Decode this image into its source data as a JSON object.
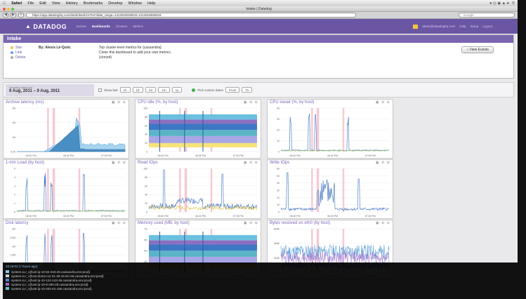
{
  "menubar": {
    "app": "Safari",
    "items": [
      "File",
      "Edit",
      "View",
      "History",
      "Bookmarks",
      "Develop",
      "Window",
      "Help"
    ]
  },
  "window": {
    "title": "Intake | Datadog"
  },
  "browser": {
    "url": "https://app.datadoghq.com/dash/dash/10754?date_range=1312919039043-1312919839043",
    "search_placeholder": "Google"
  },
  "datadog_nav": {
    "logo": "DATADOG",
    "links": [
      "Events",
      "Dashboards",
      "Clusters",
      "Metrics"
    ],
    "active": "Dashboards",
    "right": [
      "alexis@datadoghq.com",
      "Help",
      "Setup",
      "Logout"
    ]
  },
  "dashboard": {
    "title": "Intake",
    "actions": [
      {
        "label": "Star",
        "color": "#f6c443"
      },
      {
        "label": "Link",
        "color": "#6a9de0"
      },
      {
        "label": "Delete",
        "color": "#aaaaaa"
      }
    ],
    "author": "By: Alexis Lê-Quôc",
    "description_lines": [
      "Top cluster-level metrics for {cassandra}.",
      "Clone this dashboard to add your own metrics.",
      "(cloned)"
    ],
    "events_button": "View Events"
  },
  "timebar": {
    "label": "Showing data from",
    "range": "9 Aug, 2011 – 9 Aug, 2011",
    "show_last": "Show last",
    "ranges": [
      "1h",
      "1d",
      "1w",
      "1m",
      "1y"
    ],
    "pick": "Pick custom dates",
    "from": "From",
    "to": "To"
  },
  "panels": [
    {
      "title": "Archive latency (ms)",
      "yticks": [
        "2M",
        "1M",
        "1M",
        "0.00"
      ],
      "style": "area-blue"
    },
    {
      "title": "CPU idle (%, by host)",
      "yticks": [
        "100",
        "80",
        "60",
        "40",
        "20",
        "0"
      ],
      "style": "stack-band"
    },
    {
      "title": "CPU iowait (%, by host)",
      "yticks": [
        "40",
        "30",
        "20",
        "10",
        "0"
      ],
      "style": "spikes-low"
    },
    {
      "title": "1-min Load (by host)",
      "yticks": [
        "5",
        "4",
        "3",
        "2",
        "1",
        "0"
      ],
      "style": "spikes-low"
    },
    {
      "title": "Read IOps",
      "yticks": [
        "100",
        "80",
        "60",
        "40",
        "20",
        "0"
      ],
      "style": "read-iops"
    },
    {
      "title": "Write IOps",
      "yticks": [
        "60",
        "50",
        "40",
        "30",
        "20",
        "10",
        "0"
      ],
      "style": "write-iops"
    },
    {
      "title": "Disk latency",
      "yticks": [
        "3M",
        "2.5M",
        "2M",
        "1.5M",
        "1M",
        "0.5M"
      ],
      "style": "spikes-low"
    },
    {
      "title": "Memory used (MB, by host)",
      "yticks": [
        "7G",
        "6G",
        "5G",
        "4G",
        "3G"
      ],
      "style": "stack-band"
    },
    {
      "title": "Bytes received on eth0 (by host)",
      "yticks": [
        "800K",
        "600K",
        "400K",
        "200K"
      ],
      "style": "noisy"
    }
  ],
  "x_ticks": [
    "06:00 PM",
    "06:30 PM",
    "07:00 PM"
  ],
  "tooltip": {
    "header": "16:19:03 (7 hours ago)",
    "series": [
      {
        "color": "#8ec6f0",
        "label": "system.io.r_s{host:ip-10-82-234-28.cassandra,env:prod}"
      },
      {
        "color": "#cfcfcf",
        "label": "system.io.r_s{host:domU-12-31-39-16-8A-69.cassandra,env:prod}"
      },
      {
        "color": "#5b7fd6",
        "label": "system.io.r_s{host:ip-10-124-143-36.cassandra,env:prod}"
      },
      {
        "color": "#a56ec8",
        "label": "system.io.r_s{host:ip-10-8-250-28.cassandra,env:prod}"
      },
      {
        "color": "#6ac4c4",
        "label": "system.io.r_s{host:ip-10-202-61-195.cassandra,env:prod}"
      }
    ]
  }
}
